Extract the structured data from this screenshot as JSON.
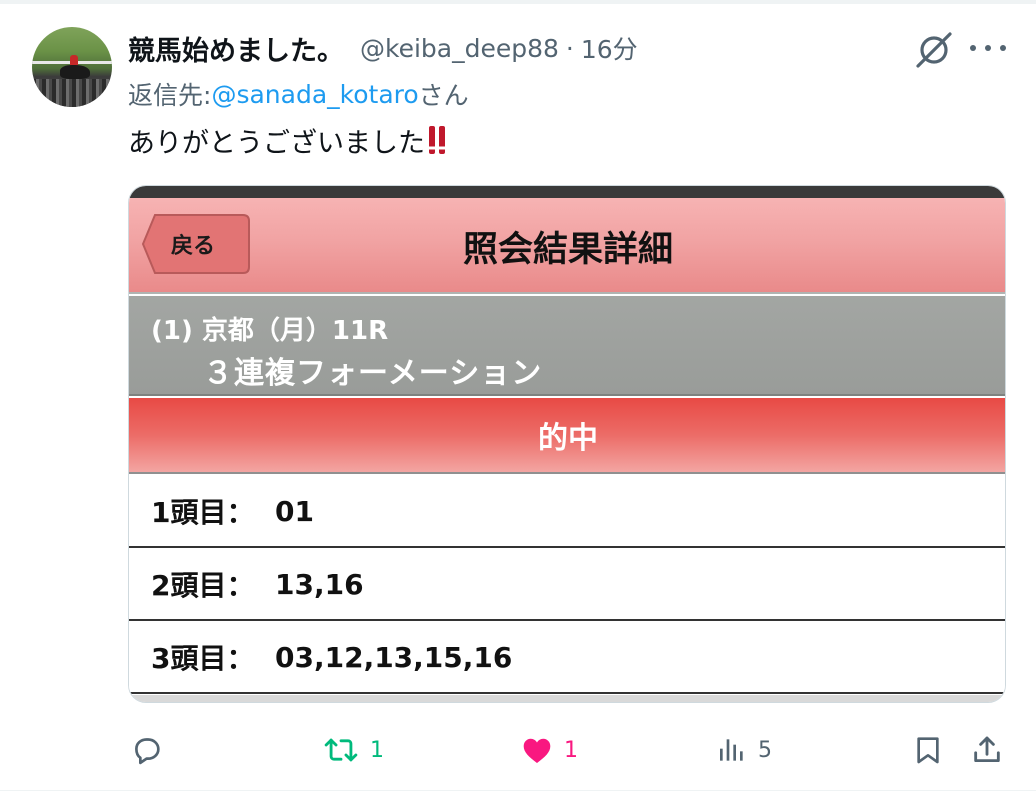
{
  "tweet": {
    "display_name": "競馬始めました。",
    "handle": "@keiba_deep88",
    "separator": "·",
    "time": "16分",
    "reply_prefix": "返信先: ",
    "reply_to": "@sanada_kotaro",
    "reply_suffix": "さん",
    "text": "ありがとうございました"
  },
  "media": {
    "back_label": "戻る",
    "title": "照会結果詳細",
    "race_info": "(1) 京都（月）11R",
    "bet_type": "３連複フォーメーション",
    "result": "的中",
    "rows": [
      {
        "label": "1頭目：",
        "value": "01"
      },
      {
        "label": "2頭目：",
        "value": "13,16"
      },
      {
        "label": "3頭目：",
        "value": "03,12,13,15,16"
      }
    ]
  },
  "actions": {
    "retweets": "1",
    "likes": "1",
    "views": "5"
  },
  "icons": {
    "grok": "grok-icon",
    "more": "more-icon",
    "reply": "reply-icon",
    "retweet": "retweet-icon",
    "like": "heart-icon",
    "views": "views-icon",
    "bookmark": "bookmark-icon",
    "share": "share-icon"
  },
  "colors": {
    "accent": "#1d9bf0",
    "retweet_green": "#00ba7c",
    "like_pink": "#f91880",
    "secondary_text": "#536471",
    "nav_pink": "#f1a3a3",
    "hit_red": "#e84a45",
    "race_gray": "#9c9f9c"
  }
}
